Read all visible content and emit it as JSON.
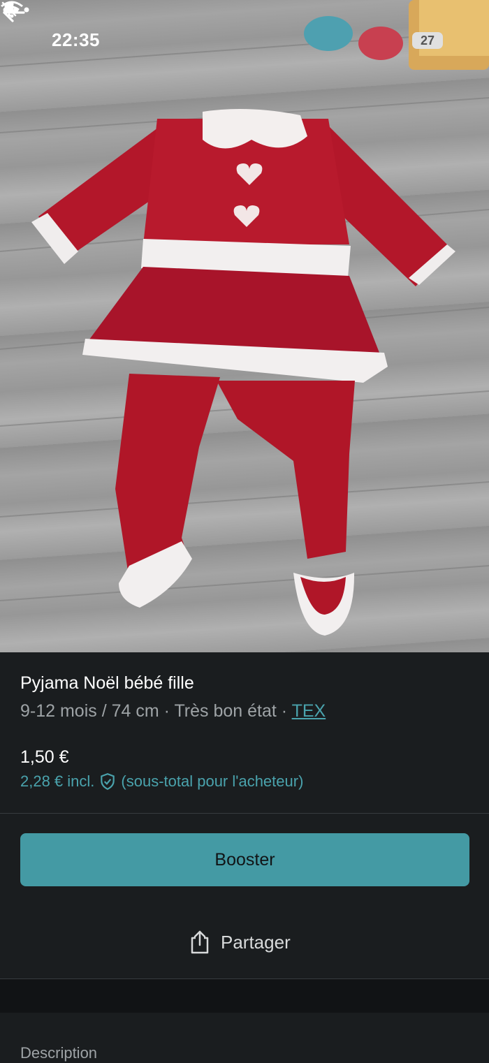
{
  "status_bar": {
    "time": "22:35",
    "battery": "27"
  },
  "icons": {
    "back": "arrow-left-icon",
    "more": "more-dots-icon",
    "bell_off": "bell-off-icon",
    "wifi": "wifi-icon",
    "shield": "shield-check-icon",
    "share": "share-icon"
  },
  "item": {
    "title": "Pyjama Noël bébé fille",
    "meta_text": "9-12 mois / 74 cm · Très bon état · ",
    "brand": "TEX",
    "price": "1,50 €",
    "buyer_price": "2,28 € incl.",
    "buyer_note": "(sous-total pour l'acheteur)"
  },
  "actions": {
    "booster_label": "Booster",
    "share_label": "Partager"
  },
  "description": {
    "heading": "Description"
  },
  "colors": {
    "accent": "#449aa4",
    "link": "#4aa3ad",
    "background": "#1a1d1f"
  }
}
